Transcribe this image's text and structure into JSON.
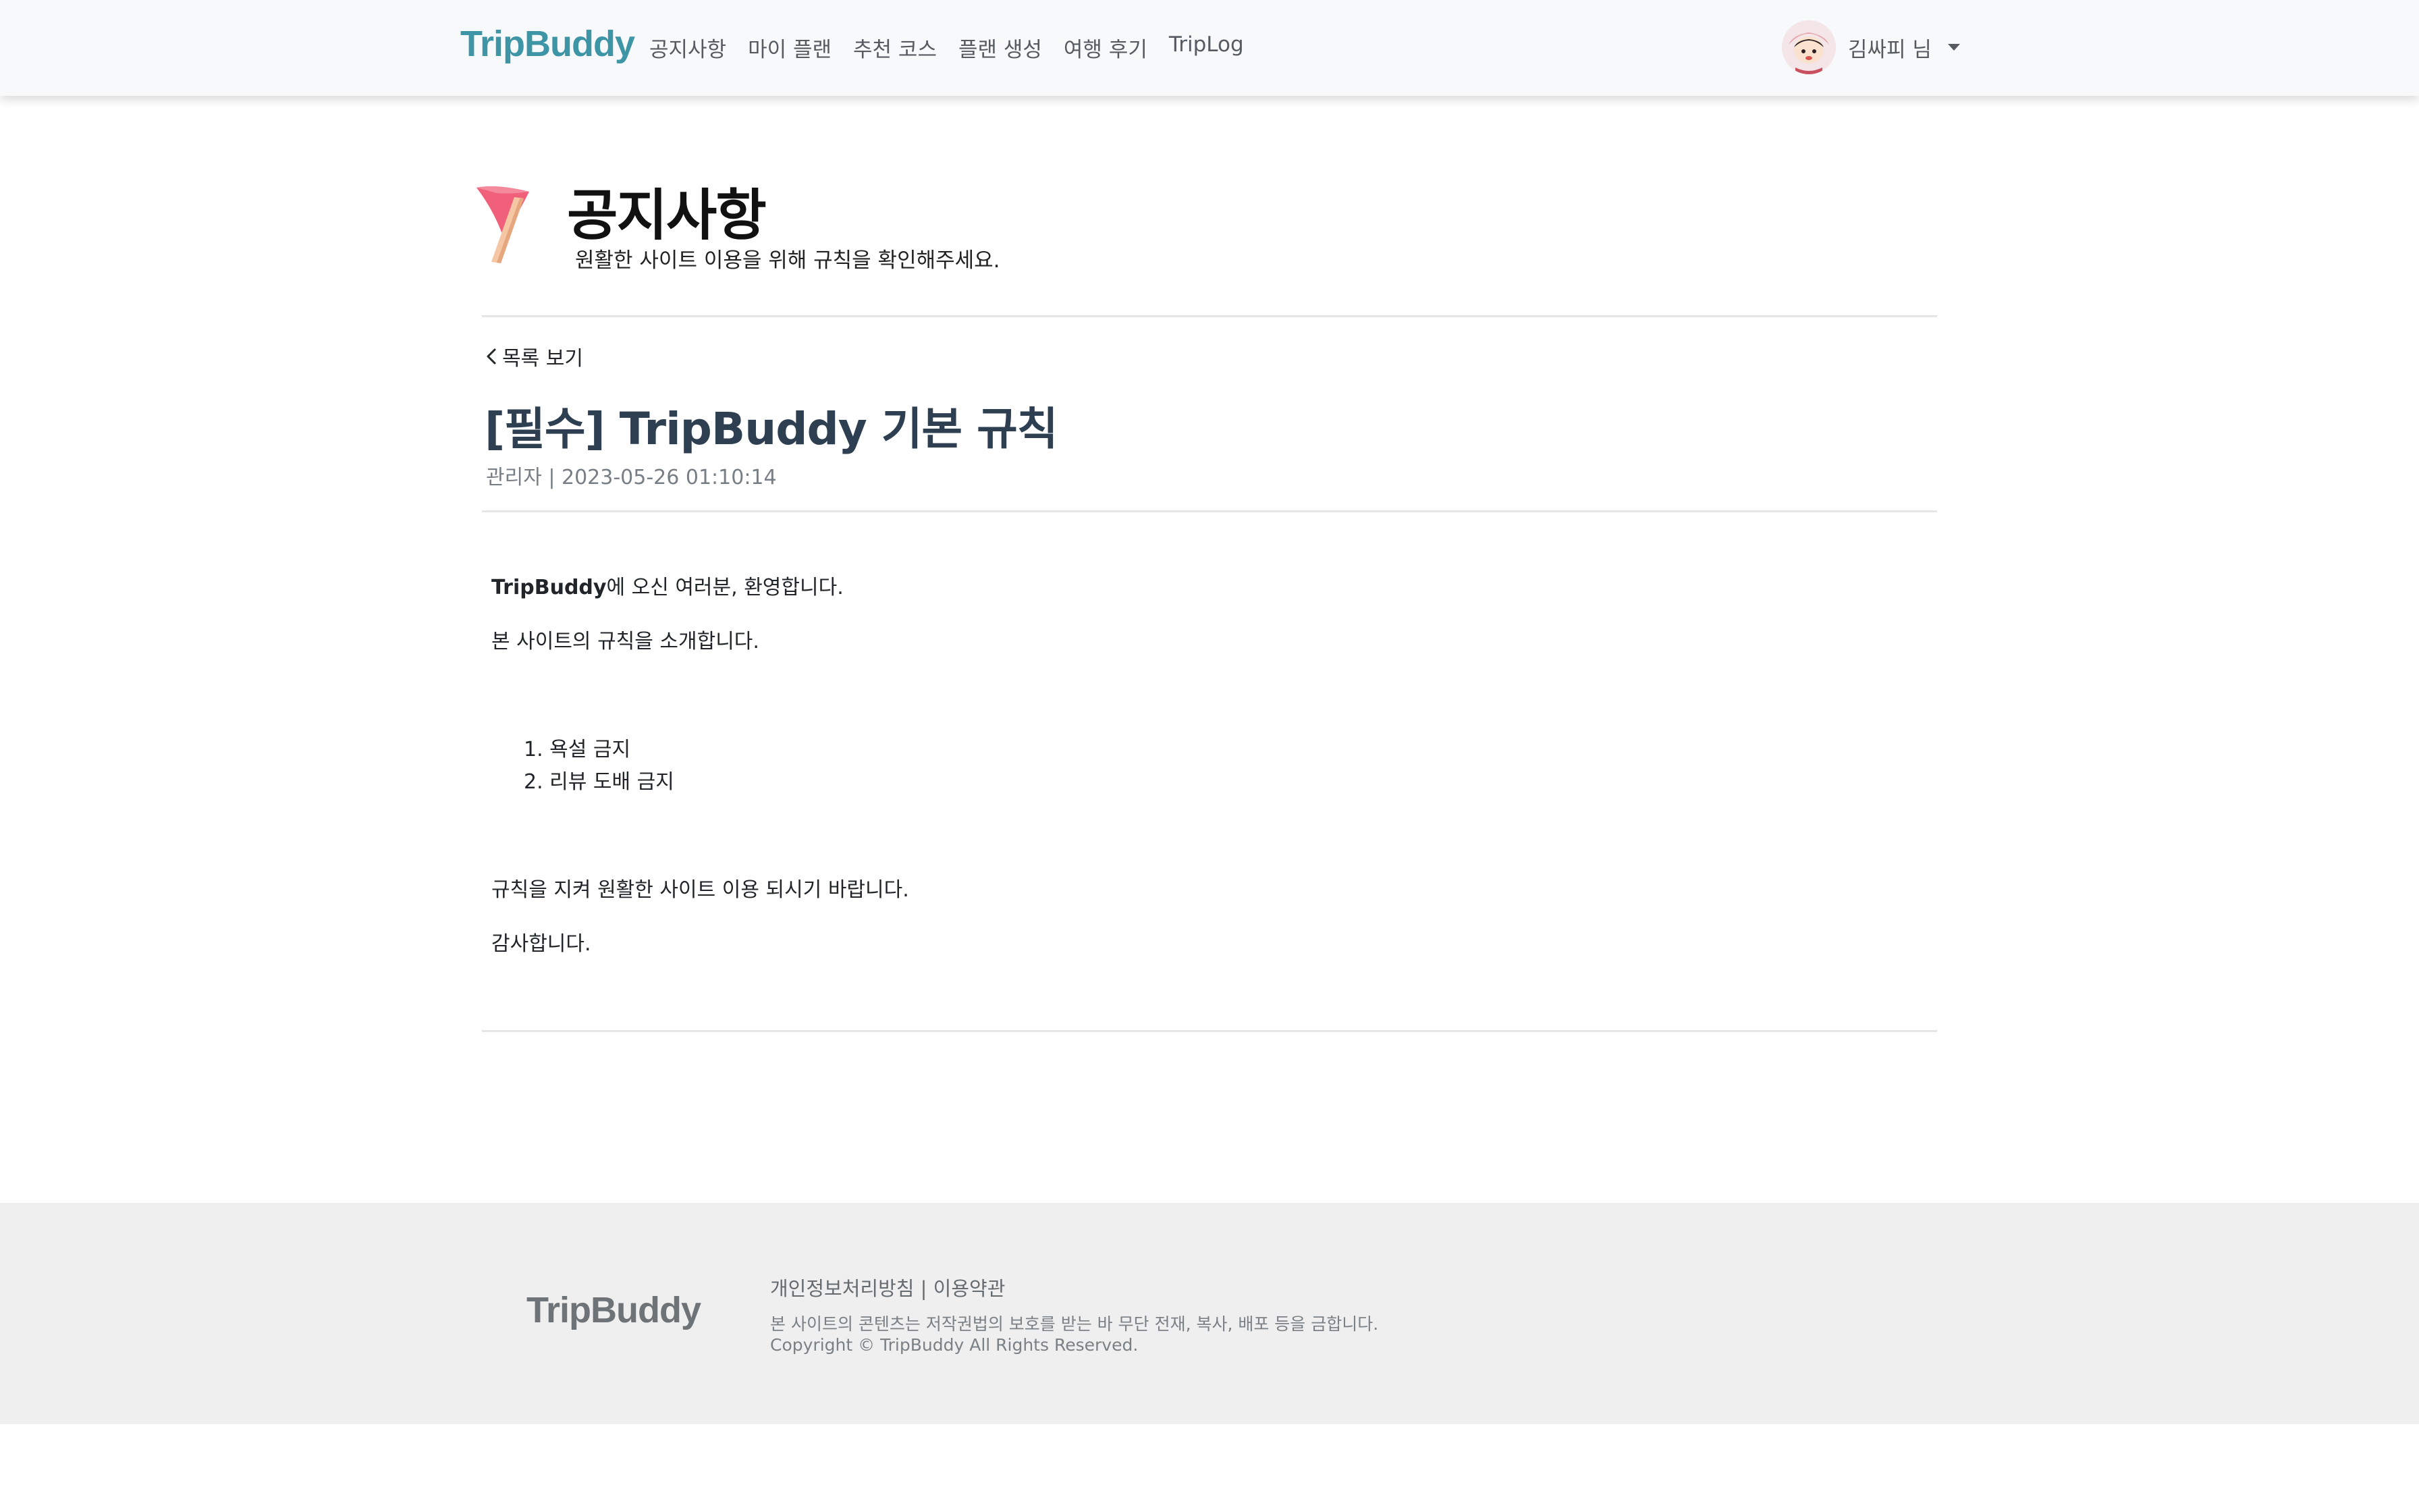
{
  "nav": {
    "brand": "TripBuddy",
    "items": [
      "공지사항",
      "마이 플랜",
      "추천 코스",
      "플랜 생성",
      "여행 후기",
      "TripLog"
    ],
    "user_name": "김싸피 님"
  },
  "header": {
    "title": "공지사항",
    "subtitle": "원활한 사이트 이용을 위해 규칙을 확인해주세요."
  },
  "post": {
    "back_label": "목록 보기",
    "title": "[필수] TripBuddy 기본 규칙",
    "meta": "관리자 | 2023-05-26 01:10:14",
    "intro_bold": "TripBuddy",
    "intro_rest": "에 오신 여러분, 환영합니다.",
    "line2": "본 사이트의 규칙을 소개합니다.",
    "rules": [
      "1. 욕설 금지",
      "2. 리뷰 도배 금지"
    ],
    "line3": "규칙을 지켜 원활한 사이트 이용 되시기 바랍니다.",
    "line4": "감사합니다."
  },
  "footer": {
    "brand": "TripBuddy",
    "privacy_link": "개인정보처리방침",
    "separator": " | ",
    "terms_link": "이용약관",
    "notice": "본 사이트의 콘텐츠는 저작권법의 보호를 받는 바 무단 전재, 복사, 배포 등을 금합니다.",
    "copyright": "Copyright © TripBuddy All Rights Reserved."
  },
  "colors": {
    "brand": "#3d95a6",
    "post_title": "#2e3f52",
    "flag": "#f0607a"
  },
  "icons": [
    "flag-icon",
    "chevron-left-icon",
    "avatar-icon",
    "caret-down-icon"
  ]
}
